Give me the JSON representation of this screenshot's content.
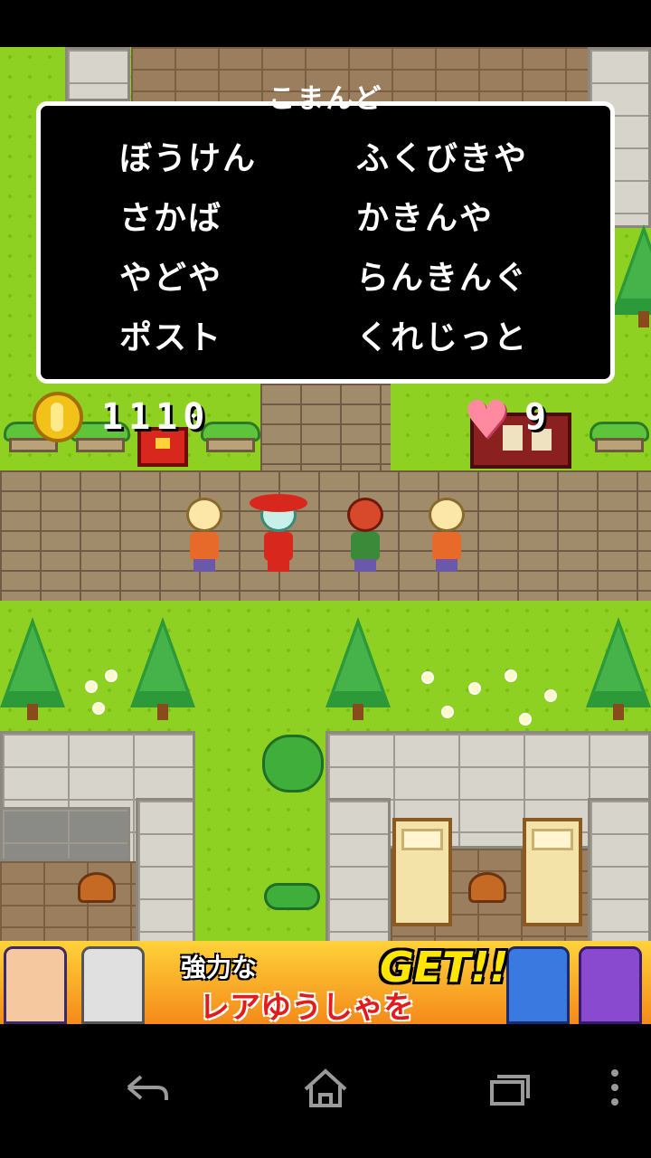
{
  "command_window": {
    "title": "こまんど",
    "commands": [
      {
        "label": "ぼうけん"
      },
      {
        "label": "ふくびきや"
      },
      {
        "label": "さかば"
      },
      {
        "label": "かきんや"
      },
      {
        "label": "やどや"
      },
      {
        "label": "らんきんぐ"
      },
      {
        "label": "ポスト"
      },
      {
        "label": "くれじっと"
      }
    ]
  },
  "hud": {
    "coins": "1110",
    "hearts": "9",
    "coin_icon": "gold-coin-icon",
    "heart_icon": "heart-icon"
  },
  "ad_banner": {
    "line1": "強力な",
    "line2": "レアゆうしゃを",
    "badge": "GET!!"
  },
  "navbar": {
    "back_icon": "back-icon",
    "home_icon": "home-icon",
    "recents_icon": "recents-icon",
    "menu_icon": "overflow-menu-icon"
  },
  "colors": {
    "grass": "#8fd122",
    "window_bg": "#000000",
    "window_border": "#ffffff",
    "text": "#ffffff"
  }
}
